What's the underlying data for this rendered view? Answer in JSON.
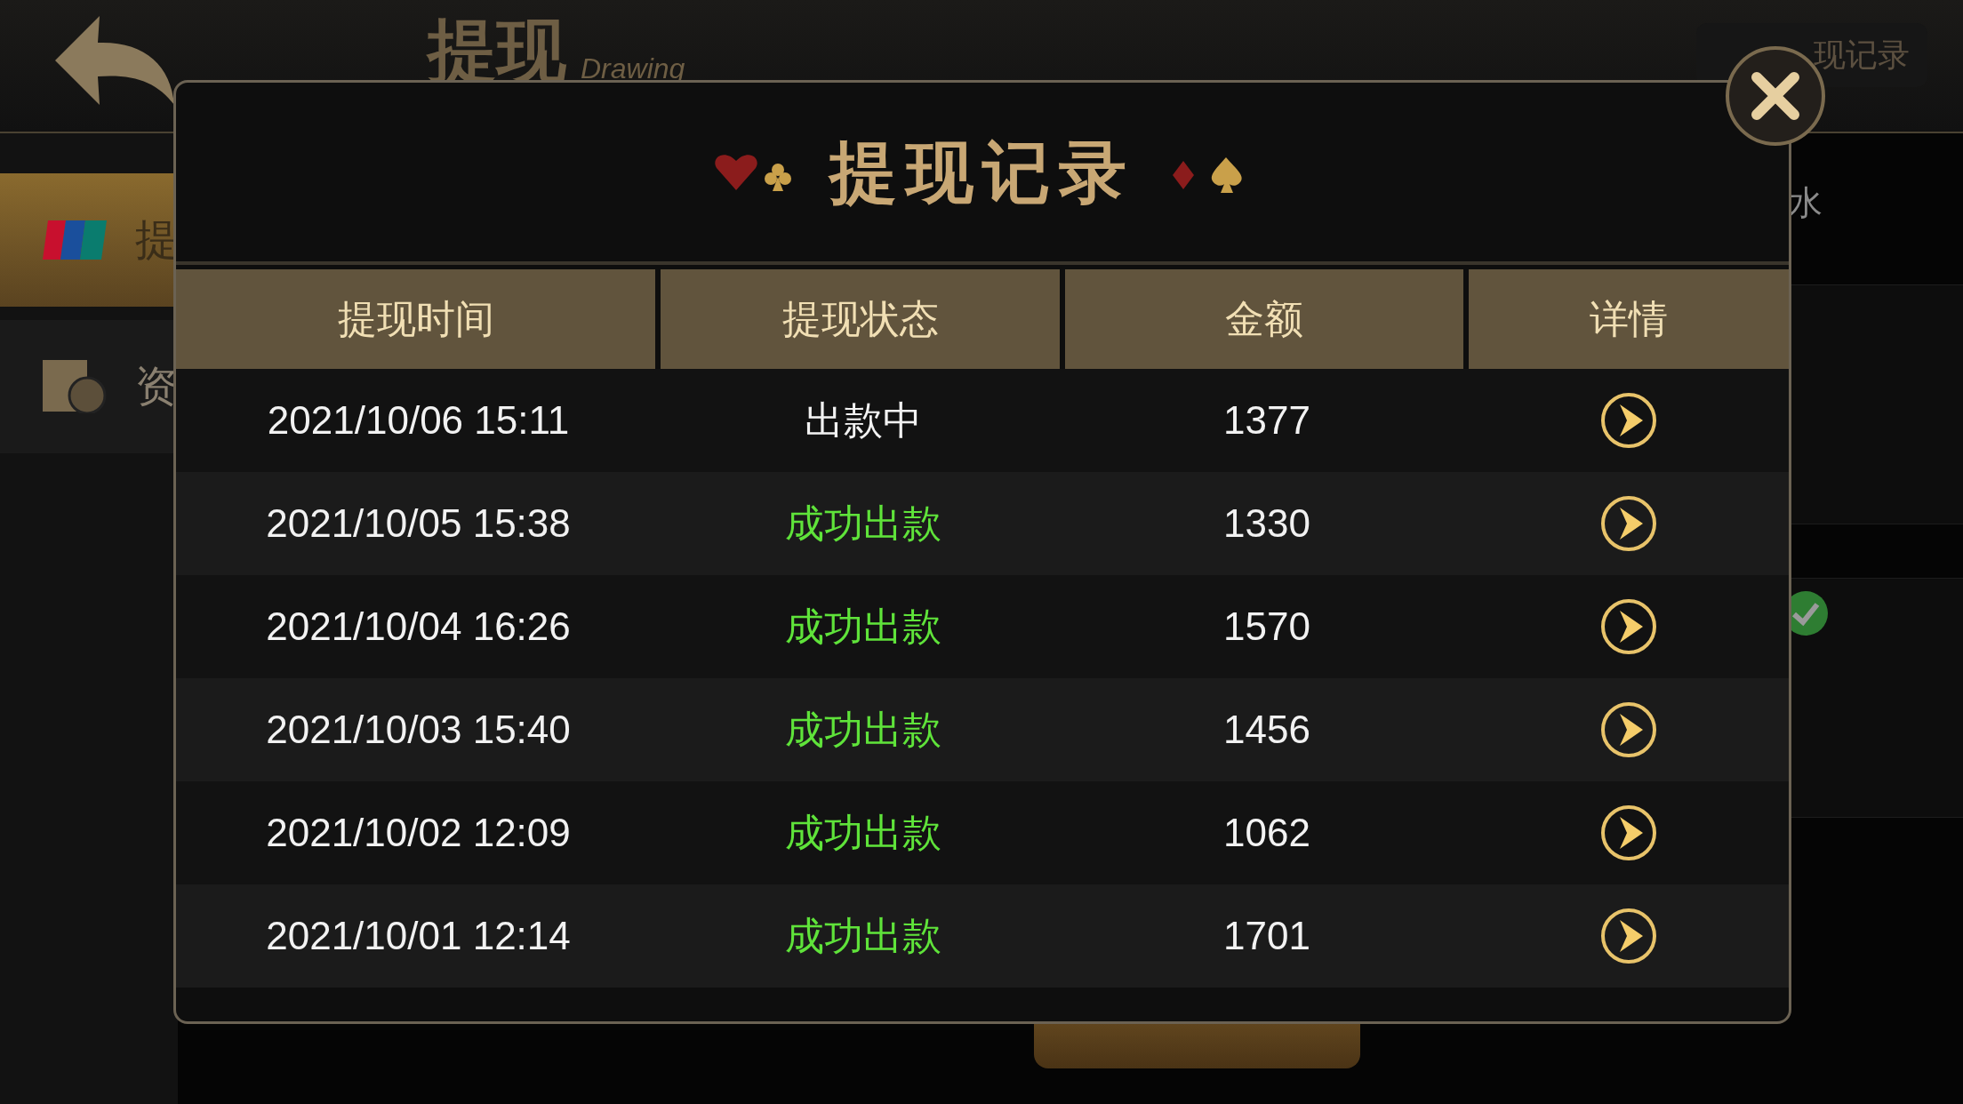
{
  "background": {
    "title": "提现",
    "subtitle": "Drawing",
    "record_button": "现记录",
    "sidebar_items": [
      {
        "label": "提",
        "selected": true
      },
      {
        "label": "资",
        "selected": false
      }
    ],
    "side_text": "水"
  },
  "dialog": {
    "title": "提现记录",
    "columns": [
      "提现时间",
      "提现状态",
      "金额",
      "详情"
    ],
    "rows": [
      {
        "time": "2021/10/06 15:11",
        "status": "出款中",
        "kind": "pending",
        "amount": "1377"
      },
      {
        "time": "2021/10/05 15:38",
        "status": "成功出款",
        "kind": "success",
        "amount": "1330"
      },
      {
        "time": "2021/10/04 16:26",
        "status": "成功出款",
        "kind": "success",
        "amount": "1570"
      },
      {
        "time": "2021/10/03 15:40",
        "status": "成功出款",
        "kind": "success",
        "amount": "1456"
      },
      {
        "time": "2021/10/02 12:09",
        "status": "成功出款",
        "kind": "success",
        "amount": "1062"
      },
      {
        "time": "2021/10/01 12:14",
        "status": "成功出款",
        "kind": "success",
        "amount": "1701"
      }
    ]
  }
}
